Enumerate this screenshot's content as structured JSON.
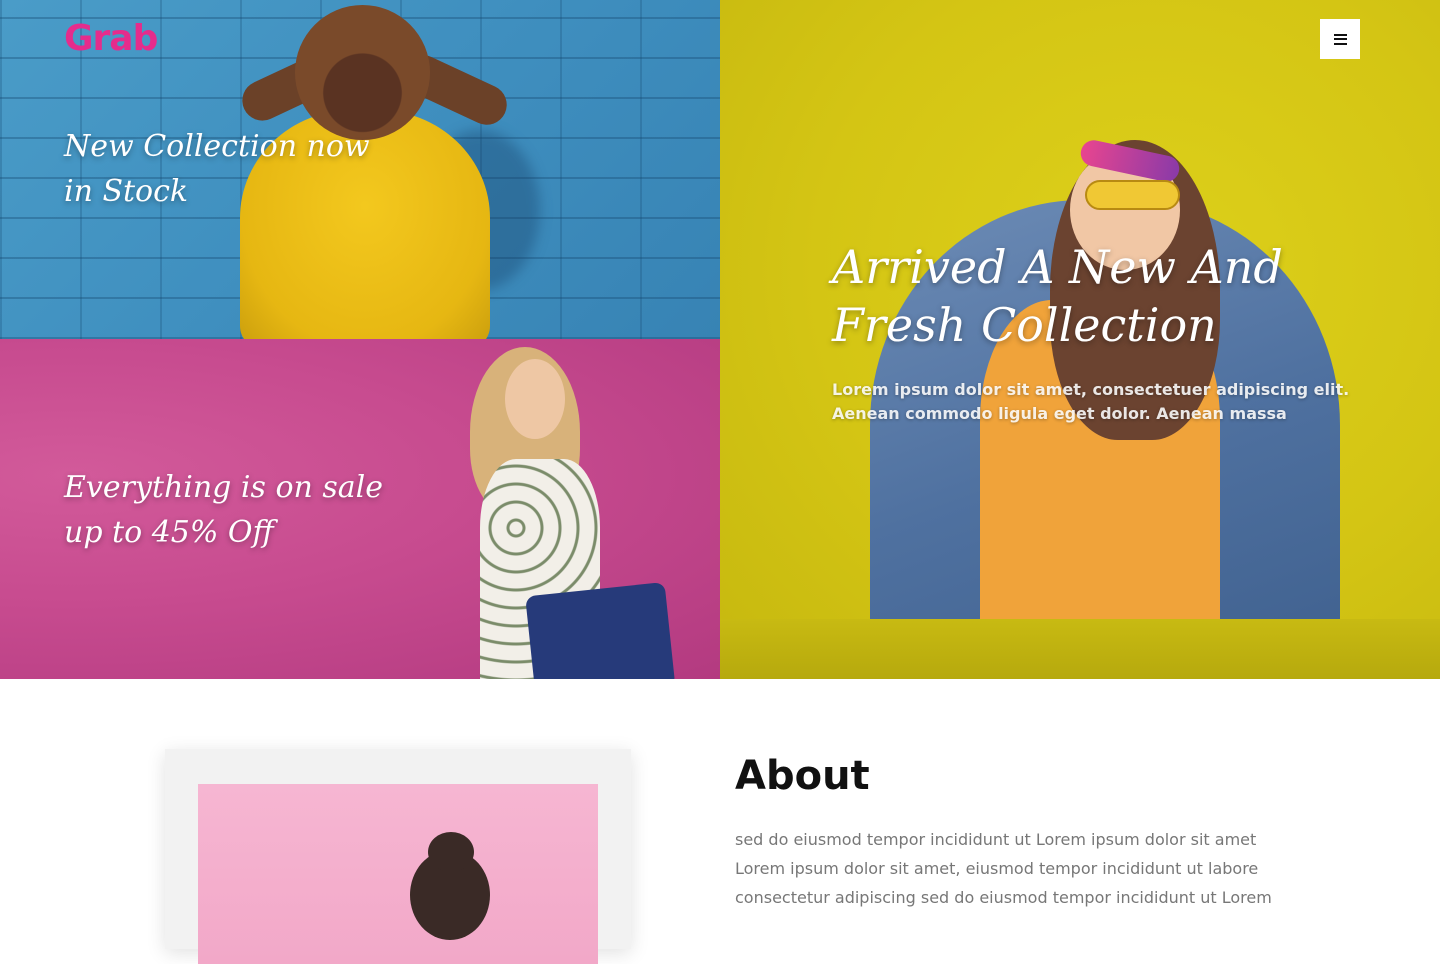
{
  "brand": {
    "logo": "Grab",
    "accent": "#e52c8c"
  },
  "header": {
    "menu_icon": "hamburger-icon"
  },
  "hero": {
    "top_left": {
      "heading_line1": "New Collection now",
      "heading_line2": "in Stock",
      "bg_color": "#4a9cc8"
    },
    "bottom_left": {
      "heading_line1": "Everything is on sale",
      "heading_line2": "up to 45% Off",
      "bg_color": "#c74b8f"
    },
    "right": {
      "heading_line1": "Arrived A New And",
      "heading_line2": "Fresh Collection",
      "subtext_line1": "Lorem ipsum dolor sit amet, consectetuer adipiscing elit.",
      "subtext_line2": "Aenean commodo ligula eget dolor. Aenean massa",
      "bg_color": "#d4c514"
    }
  },
  "about": {
    "title": "About",
    "paragraph_lines": [
      "sed do eiusmod tempor incididunt ut Lorem ipsum dolor sit amet",
      "Lorem ipsum dolor sit amet, eiusmod tempor incididunt ut labore",
      "consectetur adipiscing sed do eiusmod tempor incididunt ut Lorem"
    ]
  }
}
